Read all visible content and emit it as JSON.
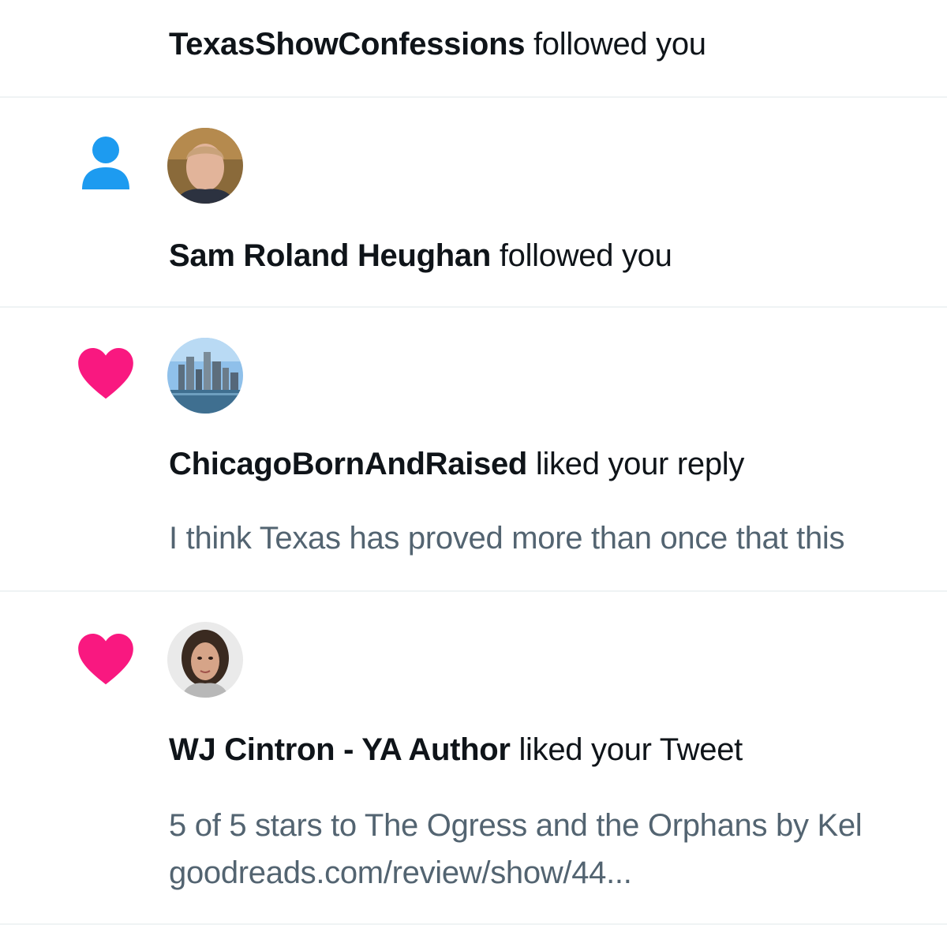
{
  "notifications": [
    {
      "type": "follow",
      "name": "TexasShowConfessions",
      "action": "followed you"
    },
    {
      "type": "follow",
      "icon": "person-icon",
      "icon_color": "#1d9bf0",
      "avatar": "avatar-man-photo",
      "name": "Sam Roland Heughan",
      "action": "followed you"
    },
    {
      "type": "like",
      "icon": "heart-icon",
      "icon_color": "#f91880",
      "avatar": "avatar-city-skyline",
      "name": "ChicagoBornAndRaised",
      "action": "liked your reply",
      "snippet": "I think Texas has proved more than once that this"
    },
    {
      "type": "like",
      "icon": "heart-icon",
      "icon_color": "#f91880",
      "avatar": "avatar-woman-photo",
      "name": "WJ Cintron - YA Author",
      "action": "liked your Tweet",
      "snippet_lines": [
        "5 of 5 stars to The Ogress and the Orphans by Kel",
        "goodreads.com/review/show/44..."
      ]
    }
  ]
}
